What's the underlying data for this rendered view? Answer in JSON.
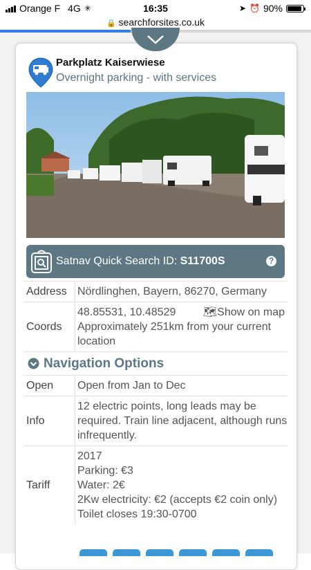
{
  "status_bar": {
    "carrier": "Orange F",
    "network": "4G",
    "time": "16:35",
    "battery": "90%",
    "battery_level": 0.9
  },
  "browser": {
    "url": "searchforsites.co.uk",
    "load_progress": 0.42
  },
  "site": {
    "name": "Parkplatz Kaiserwiese",
    "type": "Overnight parking - with services",
    "satnav_label": "Satnav Quick Search ID: ",
    "satnav_id": "S11700S",
    "help": "?"
  },
  "details": {
    "address_label": "Address",
    "address": "Nördlinghen, Bayern, 86270, Germany",
    "coords_label": "Coords",
    "coords": "48.85531, 10.48529",
    "show_on_map": "Show on map",
    "distance": "Approximately 251km from your current location",
    "nav_options": "Navigation Options",
    "open_label": "Open",
    "open": "Open from Jan to Dec",
    "info_label": "Info",
    "info": "12 electric points, long leads may be required. Train line adjacent, although runs infrequently.",
    "tariff_label": "Tariff",
    "tariff_lines": [
      "2017",
      "Parking: €3",
      "Water: 2€",
      "2Kw electricity: €2 (accepts €2 coin only)",
      "Toilet closes 19:30-0700"
    ]
  },
  "colors": {
    "accent": "#5d7783",
    "open_green": "#3ca63c",
    "pin_blue": "#2f7cd0"
  }
}
